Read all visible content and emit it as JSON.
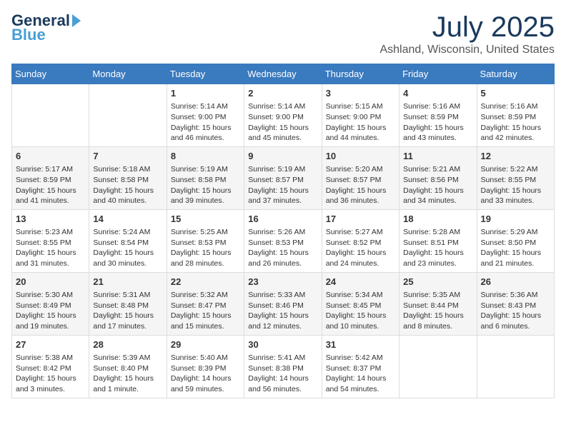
{
  "header": {
    "logo_general": "General",
    "logo_blue": "Blue",
    "month": "July 2025",
    "location": "Ashland, Wisconsin, United States"
  },
  "days_of_week": [
    "Sunday",
    "Monday",
    "Tuesday",
    "Wednesday",
    "Thursday",
    "Friday",
    "Saturday"
  ],
  "weeks": [
    [
      null,
      null,
      {
        "day": 1,
        "sunrise": "5:14 AM",
        "sunset": "9:00 PM",
        "daylight": "15 hours and 46 minutes."
      },
      {
        "day": 2,
        "sunrise": "5:14 AM",
        "sunset": "9:00 PM",
        "daylight": "15 hours and 45 minutes."
      },
      {
        "day": 3,
        "sunrise": "5:15 AM",
        "sunset": "9:00 PM",
        "daylight": "15 hours and 44 minutes."
      },
      {
        "day": 4,
        "sunrise": "5:16 AM",
        "sunset": "8:59 PM",
        "daylight": "15 hours and 43 minutes."
      },
      {
        "day": 5,
        "sunrise": "5:16 AM",
        "sunset": "8:59 PM",
        "daylight": "15 hours and 42 minutes."
      }
    ],
    [
      {
        "day": 6,
        "sunrise": "5:17 AM",
        "sunset": "8:59 PM",
        "daylight": "15 hours and 41 minutes."
      },
      {
        "day": 7,
        "sunrise": "5:18 AM",
        "sunset": "8:58 PM",
        "daylight": "15 hours and 40 minutes."
      },
      {
        "day": 8,
        "sunrise": "5:19 AM",
        "sunset": "8:58 PM",
        "daylight": "15 hours and 39 minutes."
      },
      {
        "day": 9,
        "sunrise": "5:19 AM",
        "sunset": "8:57 PM",
        "daylight": "15 hours and 37 minutes."
      },
      {
        "day": 10,
        "sunrise": "5:20 AM",
        "sunset": "8:57 PM",
        "daylight": "15 hours and 36 minutes."
      },
      {
        "day": 11,
        "sunrise": "5:21 AM",
        "sunset": "8:56 PM",
        "daylight": "15 hours and 34 minutes."
      },
      {
        "day": 12,
        "sunrise": "5:22 AM",
        "sunset": "8:55 PM",
        "daylight": "15 hours and 33 minutes."
      }
    ],
    [
      {
        "day": 13,
        "sunrise": "5:23 AM",
        "sunset": "8:55 PM",
        "daylight": "15 hours and 31 minutes."
      },
      {
        "day": 14,
        "sunrise": "5:24 AM",
        "sunset": "8:54 PM",
        "daylight": "15 hours and 30 minutes."
      },
      {
        "day": 15,
        "sunrise": "5:25 AM",
        "sunset": "8:53 PM",
        "daylight": "15 hours and 28 minutes."
      },
      {
        "day": 16,
        "sunrise": "5:26 AM",
        "sunset": "8:53 PM",
        "daylight": "15 hours and 26 minutes."
      },
      {
        "day": 17,
        "sunrise": "5:27 AM",
        "sunset": "8:52 PM",
        "daylight": "15 hours and 24 minutes."
      },
      {
        "day": 18,
        "sunrise": "5:28 AM",
        "sunset": "8:51 PM",
        "daylight": "15 hours and 23 minutes."
      },
      {
        "day": 19,
        "sunrise": "5:29 AM",
        "sunset": "8:50 PM",
        "daylight": "15 hours and 21 minutes."
      }
    ],
    [
      {
        "day": 20,
        "sunrise": "5:30 AM",
        "sunset": "8:49 PM",
        "daylight": "15 hours and 19 minutes."
      },
      {
        "day": 21,
        "sunrise": "5:31 AM",
        "sunset": "8:48 PM",
        "daylight": "15 hours and 17 minutes."
      },
      {
        "day": 22,
        "sunrise": "5:32 AM",
        "sunset": "8:47 PM",
        "daylight": "15 hours and 15 minutes."
      },
      {
        "day": 23,
        "sunrise": "5:33 AM",
        "sunset": "8:46 PM",
        "daylight": "15 hours and 12 minutes."
      },
      {
        "day": 24,
        "sunrise": "5:34 AM",
        "sunset": "8:45 PM",
        "daylight": "15 hours and 10 minutes."
      },
      {
        "day": 25,
        "sunrise": "5:35 AM",
        "sunset": "8:44 PM",
        "daylight": "15 hours and 8 minutes."
      },
      {
        "day": 26,
        "sunrise": "5:36 AM",
        "sunset": "8:43 PM",
        "daylight": "15 hours and 6 minutes."
      }
    ],
    [
      {
        "day": 27,
        "sunrise": "5:38 AM",
        "sunset": "8:42 PM",
        "daylight": "15 hours and 3 minutes."
      },
      {
        "day": 28,
        "sunrise": "5:39 AM",
        "sunset": "8:40 PM",
        "daylight": "15 hours and 1 minute."
      },
      {
        "day": 29,
        "sunrise": "5:40 AM",
        "sunset": "8:39 PM",
        "daylight": "14 hours and 59 minutes."
      },
      {
        "day": 30,
        "sunrise": "5:41 AM",
        "sunset": "8:38 PM",
        "daylight": "14 hours and 56 minutes."
      },
      {
        "day": 31,
        "sunrise": "5:42 AM",
        "sunset": "8:37 PM",
        "daylight": "14 hours and 54 minutes."
      },
      null,
      null
    ]
  ]
}
